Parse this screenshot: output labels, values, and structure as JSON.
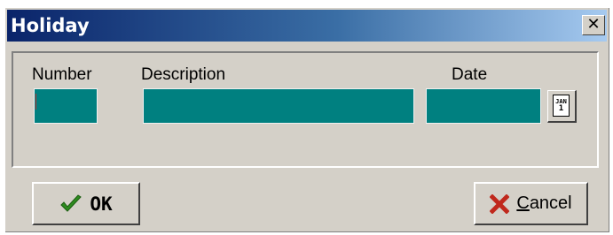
{
  "window": {
    "title": "Holiday",
    "close_glyph": "✕"
  },
  "fields": {
    "number": {
      "label": "Number",
      "value": ""
    },
    "description": {
      "label": "Description",
      "value": ""
    },
    "date": {
      "label": "Date",
      "value": ""
    }
  },
  "calendar_button": {
    "icon": "calendar-icon",
    "month_text": "JAN",
    "day_text": "1"
  },
  "buttons": {
    "ok": {
      "label": "OK",
      "icon": "checkmark-icon",
      "icon_color": "#2e8b1f"
    },
    "cancel": {
      "label": "Cancel",
      "icon": "x-icon",
      "icon_color": "#c0281c"
    }
  },
  "colors": {
    "field_fill": "#008080",
    "title_gradient_start": "#0a246a",
    "title_gradient_end": "#a6caf0",
    "dialog_background": "#d4d0c8"
  }
}
